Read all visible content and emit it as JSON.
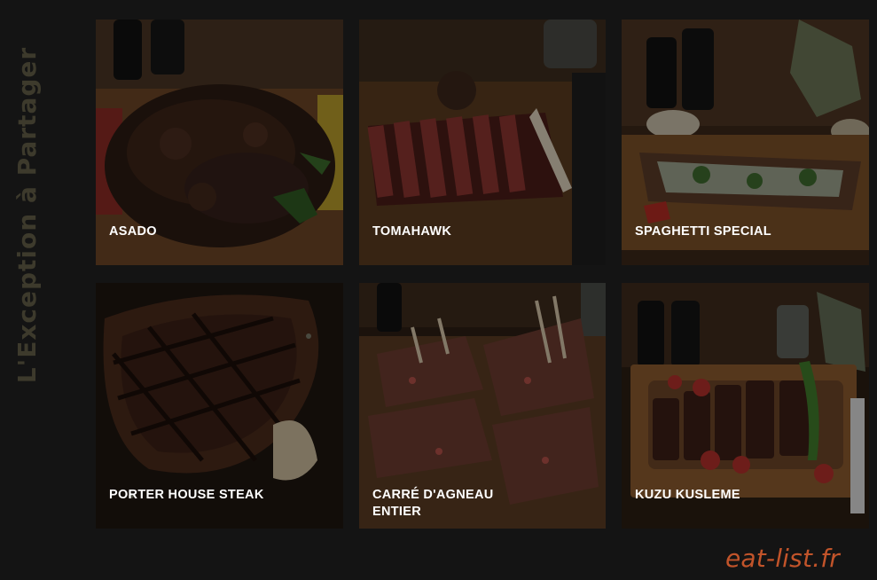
{
  "side_title": "L'Exception à Partager",
  "dishes": [
    {
      "name": "ASADO"
    },
    {
      "name": "TOMAHAWK"
    },
    {
      "name": "SPAGHETTI SPECIAL"
    },
    {
      "name": "PORTER HOUSE STEAK"
    },
    {
      "name": "CARRÉ D'AGNEAU\nENTIER"
    },
    {
      "name": "KUZU KUSLEME"
    }
  ],
  "watermark": "eat-list.fr",
  "colors": {
    "background": "#141414",
    "side_title": "#3d3a2c",
    "watermark": "#c2542a",
    "label": "#ffffff"
  }
}
